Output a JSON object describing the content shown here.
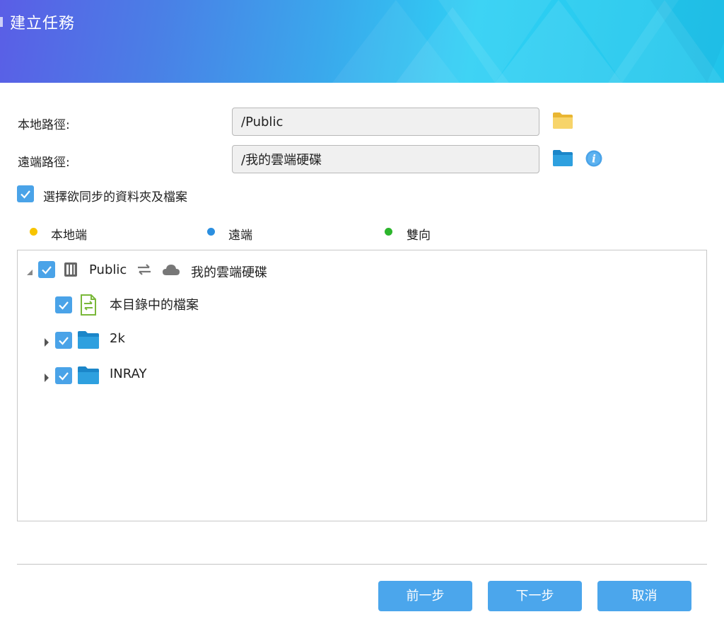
{
  "header": {
    "title": "建立任務"
  },
  "form": {
    "local_path_label": "本地路徑:",
    "local_path_value": "/Public",
    "remote_path_label": "遠端路徑:",
    "remote_path_value": "/我的雲端硬碟",
    "select_sync_label": "選擇欲同步的資料夾及檔案"
  },
  "legend": [
    {
      "label": "本地端",
      "color": "#f7c400"
    },
    {
      "label": "遠端",
      "color": "#2b8fe0"
    },
    {
      "label": "雙向",
      "color": "#2cb52c"
    }
  ],
  "tree": {
    "root_local": "Public",
    "root_remote": "我的雲端硬碟",
    "items": [
      {
        "label": "本目錄中的檔案"
      },
      {
        "label": "2k"
      },
      {
        "label": "INRAY"
      }
    ]
  },
  "buttons": {
    "prev": "前一步",
    "next": "下一步",
    "cancel": "取消"
  },
  "colors": {
    "accent": "#4ba6ec",
    "checkbox": "#4aa3e8",
    "folder_blue": "#2ea0df",
    "folder_yellow": "#f5c84a"
  },
  "icons": [
    "folder-icon",
    "info-icon",
    "check-icon",
    "nas-icon",
    "sync-arrows-icon",
    "cloud-icon",
    "file-sync-icon",
    "expand-arrow-icon",
    "collapse-arrow-icon"
  ]
}
